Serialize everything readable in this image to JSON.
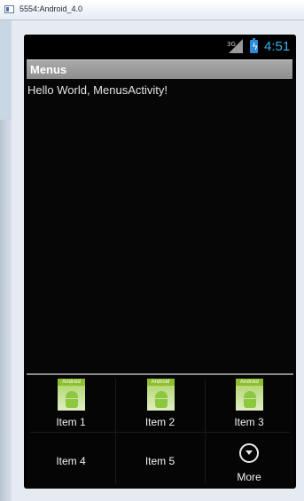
{
  "window": {
    "title": "5554:Android_4.0"
  },
  "statusbar": {
    "network": "3G",
    "time": "4:51"
  },
  "actionbar": {
    "title": "Menus"
  },
  "content": {
    "text": "Hello World, MenusActivity!"
  },
  "menu": {
    "items": [
      {
        "label": "Item 1",
        "icon": "android-icon"
      },
      {
        "label": "Item 2",
        "icon": "android-icon"
      },
      {
        "label": "Item 3",
        "icon": "android-icon"
      },
      {
        "label": "Item 4"
      },
      {
        "label": "Item 5"
      },
      {
        "label": "More",
        "icon": "chevron-down-circle-icon"
      }
    ],
    "icon_badge_text": "Android"
  }
}
